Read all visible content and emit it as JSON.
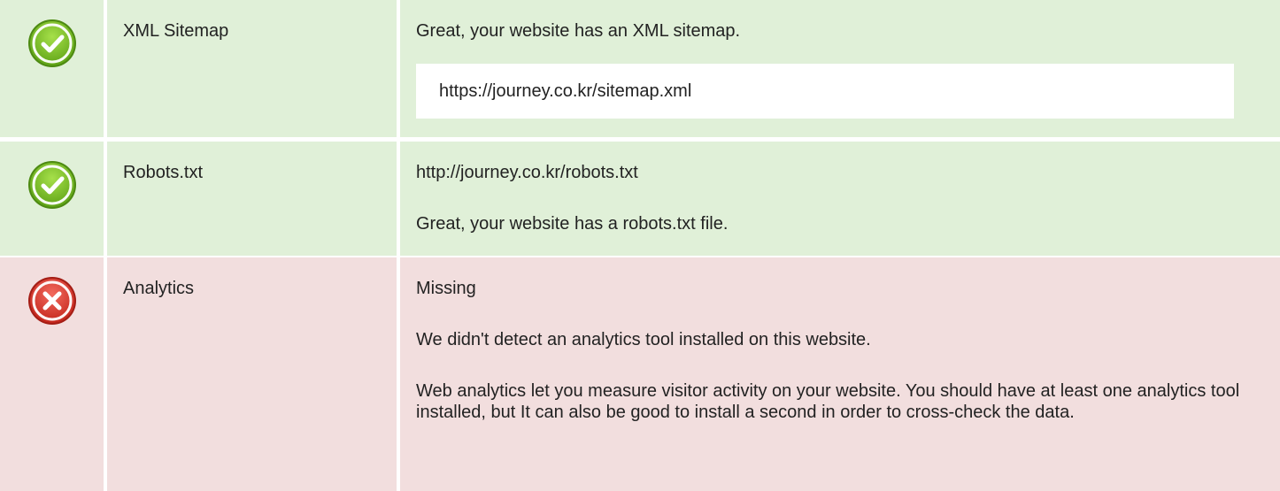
{
  "rows": [
    {
      "status": "pass",
      "icon": "check-circle-icon",
      "name": "XML Sitemap",
      "message": "Great, your website has an XML sitemap.",
      "url": "https://journey.co.kr/sitemap.xml"
    },
    {
      "status": "pass",
      "icon": "check-circle-icon",
      "name": "Robots.txt",
      "url": "http://journey.co.kr/robots.txt",
      "message": "Great, your website has a robots.txt file."
    },
    {
      "status": "fail",
      "icon": "error-circle-icon",
      "name": "Analytics",
      "value": "Missing",
      "message": "We didn't detect an analytics tool installed on this website.",
      "description": "Web analytics let you measure visitor activity on your website. You should have at least one analytics tool installed, but It can also be good to install a second in order to cross-check the data."
    }
  ],
  "colors": {
    "pass_bg": "#e0f0d8",
    "fail_bg": "#f2dede",
    "pass_icon": "#7cbf2a",
    "fail_icon": "#d9342b"
  }
}
